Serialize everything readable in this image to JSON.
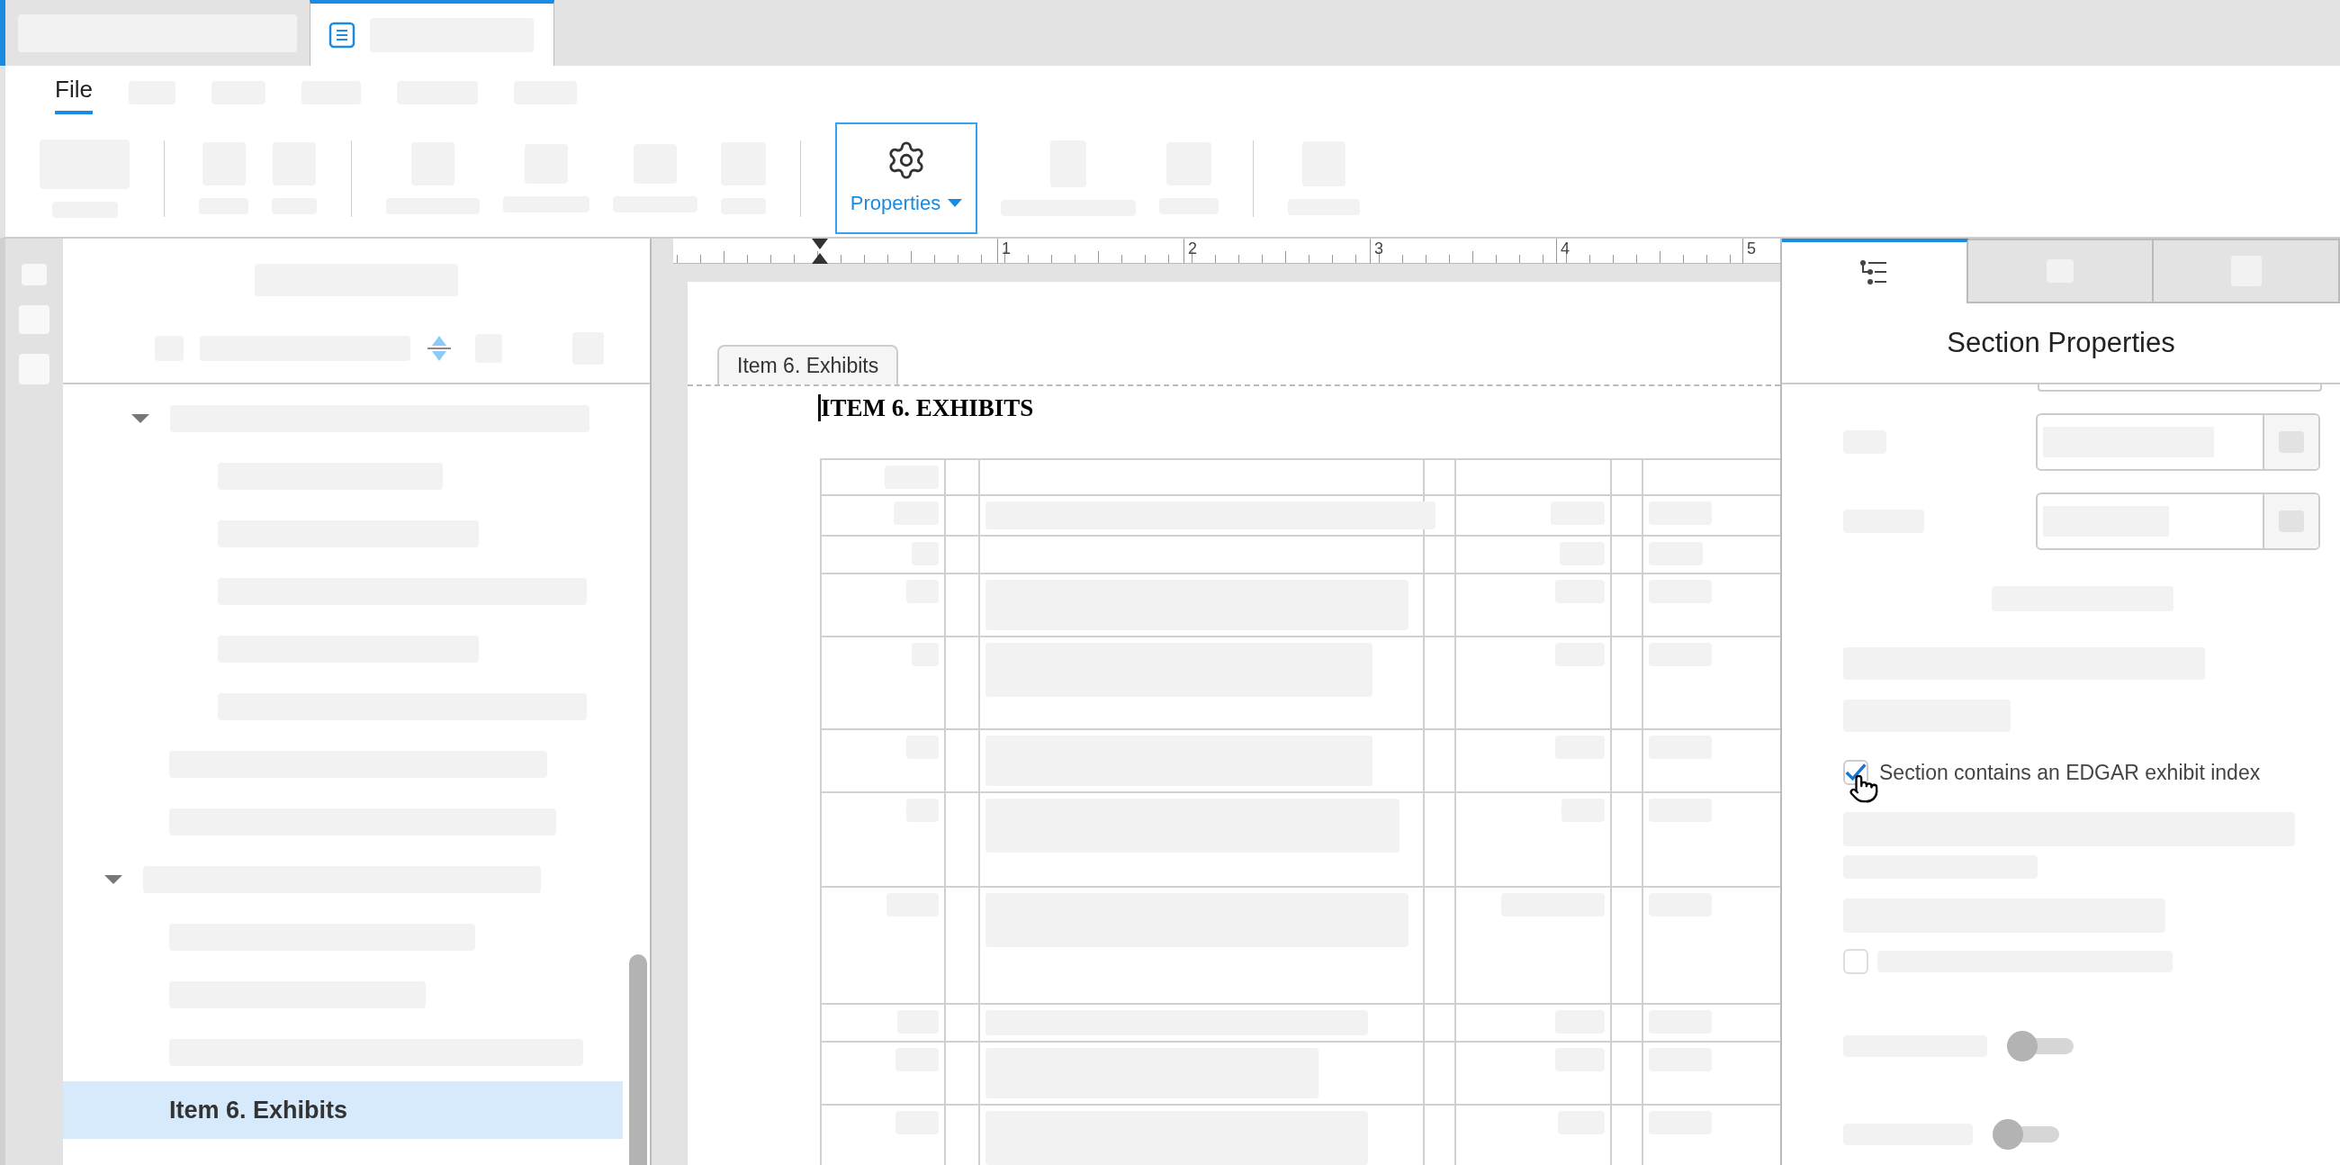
{
  "menu_tabs": [
    {
      "label": "File",
      "selected": true
    }
  ],
  "toolbar": {
    "properties_button": {
      "label": "Properties"
    }
  },
  "ruler": {
    "marks": [
      "1",
      "2",
      "3",
      "4",
      "5"
    ]
  },
  "outline": {
    "continued": [
      {
        "expanded": true,
        "selected": false,
        "children": [
          {
            "selected": false
          },
          {
            "selected": false
          },
          {
            "selected": false
          },
          {
            "selected": false
          },
          {
            "selected": false
          }
        ]
      },
      {
        "selected": false
      },
      {
        "selected": false
      }
    ],
    "items": [
      {
        "expanded": true,
        "selected": false,
        "children": [
          {
            "selected": false
          },
          {
            "selected": false
          },
          {
            "selected": false
          },
          {
            "label": "Item 6. Exhibits",
            "selected": true
          }
        ]
      }
    ]
  },
  "document": {
    "section_tag": "Item 6. Exhibits",
    "heading": "ITEM 6. EXHIBITS"
  },
  "panel": {
    "tabs": [
      {
        "selected": true
      },
      {
        "selected": false
      },
      {
        "selected": false
      }
    ],
    "title": "Section Properties",
    "checkboxes": [
      {
        "label": "Section contains an EDGAR exhibit index",
        "checked": true
      },
      {
        "checked": false
      }
    ],
    "toggles": [
      {
        "on": false
      },
      {
        "on": false
      }
    ]
  }
}
